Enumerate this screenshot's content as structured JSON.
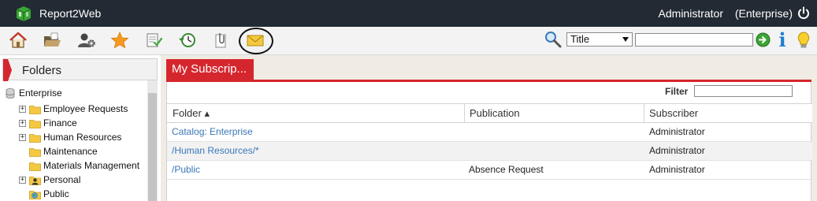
{
  "app": {
    "title": "Report2Web",
    "user": "Administrator",
    "edition": "(Enterprise)"
  },
  "toolbar": {
    "icons": [
      "home-icon",
      "folder-open-icon",
      "user-settings-icon",
      "favorites-star-icon",
      "publish-icon",
      "history-icon",
      "attachment-icon",
      "mail-icon"
    ],
    "search_field": "Title",
    "search_value": "",
    "accent_green": "#3aa635",
    "info_color": "#1f7fd0"
  },
  "left_panel": {
    "title": "Folders",
    "root": "Enterprise",
    "items": [
      {
        "label": "Employee Requests",
        "expandable": true
      },
      {
        "label": "Finance",
        "expandable": true
      },
      {
        "label": "Human Resources",
        "expandable": true
      },
      {
        "label": "Maintenance",
        "expandable": false
      },
      {
        "label": "Materials Management",
        "expandable": false
      },
      {
        "label": "Personal",
        "expandable": true
      },
      {
        "label": "Public",
        "expandable": false
      }
    ]
  },
  "main": {
    "tab_label": "My Subscrip...",
    "filter_label": "Filter",
    "filter_value": "",
    "columns": [
      "Folder ▴",
      "Publication",
      "Subscriber"
    ],
    "rows": [
      {
        "folder": "Catalog: Enterprise",
        "publication": "",
        "subscriber": "Administrator"
      },
      {
        "folder": "/Human Resources/*",
        "publication": "",
        "subscriber": "Administrator"
      },
      {
        "folder": "/Public",
        "publication": "Absence Request",
        "subscriber": "Administrator"
      }
    ]
  },
  "colors": {
    "titlebar": "#222a33",
    "accent_red": "#d6262d",
    "link_blue": "#3a78b8"
  }
}
